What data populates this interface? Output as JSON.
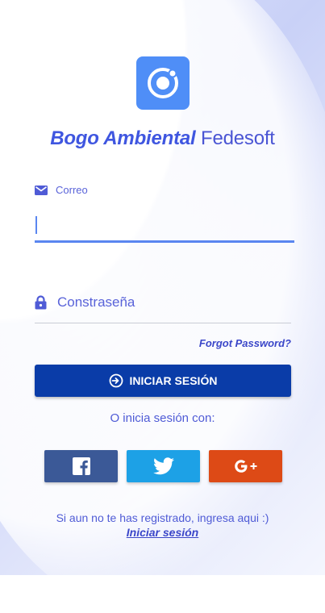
{
  "app": {
    "title_bold": "Bogo Ambiental",
    "title_regular": "Fedesoft",
    "logo_icon": "ionic-logo-icon"
  },
  "form": {
    "email_label": "Correo",
    "email_icon": "mail-icon",
    "email_value": "",
    "password_placeholder": "Constraseña",
    "password_icon": "lock-icon",
    "forgot_label": "Forgot Password?",
    "login_label": "INICIAR SESIÓN",
    "login_icon": "log-in-icon"
  },
  "social": {
    "prompt": "O inicia sesión con:",
    "buttons": [
      {
        "name": "facebook",
        "icon": "facebook-icon",
        "color": "#3b5997"
      },
      {
        "name": "twitter",
        "icon": "twitter-icon",
        "color": "#1da1e6"
      },
      {
        "name": "google-plus",
        "icon": "google-plus-icon",
        "color": "#dd4a16"
      }
    ]
  },
  "register": {
    "text": "Si aun no te has registrado, ingresa aqui :)",
    "link_label": "Iniciar sesión"
  },
  "colors": {
    "accent": "#4a55d4",
    "primary_button": "#0a3ca8",
    "logo_bg": "#4f8ef7",
    "input_active": "#5a86f0"
  }
}
